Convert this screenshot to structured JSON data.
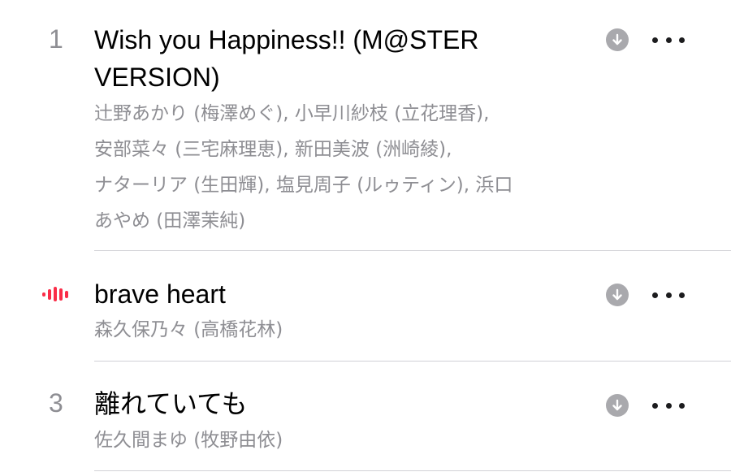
{
  "colors": {
    "accent": "#fa2d48",
    "secondary_text": "#8e8e93",
    "primary_text": "#000000",
    "download_icon_bg": "#a9a9ad",
    "divider": "#d1d1d6"
  },
  "tracks": [
    {
      "number": "1",
      "title_line1": "Wish you Happiness!! (M@STER",
      "title_line2": "VERSION)",
      "artist_lines": [
        "辻野あかり (梅澤めぐ), 小早川紗枝 (立花理香),",
        "安部菜々 (三宅麻理恵), 新田美波 (洲崎綾),",
        "ナターリア (生田輝), 塩見周子 (ルゥティン), 浜口",
        "あやめ (田澤茉純)"
      ],
      "download_icon": "download-arrow-icon",
      "more_icon": "ellipsis-icon"
    },
    {
      "now_playing_icon": "now-playing-waveform-icon",
      "title": "brave heart",
      "artist": "森久保乃々 (高橋花林)",
      "download_icon": "download-arrow-icon",
      "more_icon": "ellipsis-icon"
    },
    {
      "number": "3",
      "title": "離れていても",
      "artist": "佐久間まゆ (牧野由依)",
      "download_icon": "download-arrow-icon",
      "more_icon": "ellipsis-icon"
    }
  ]
}
